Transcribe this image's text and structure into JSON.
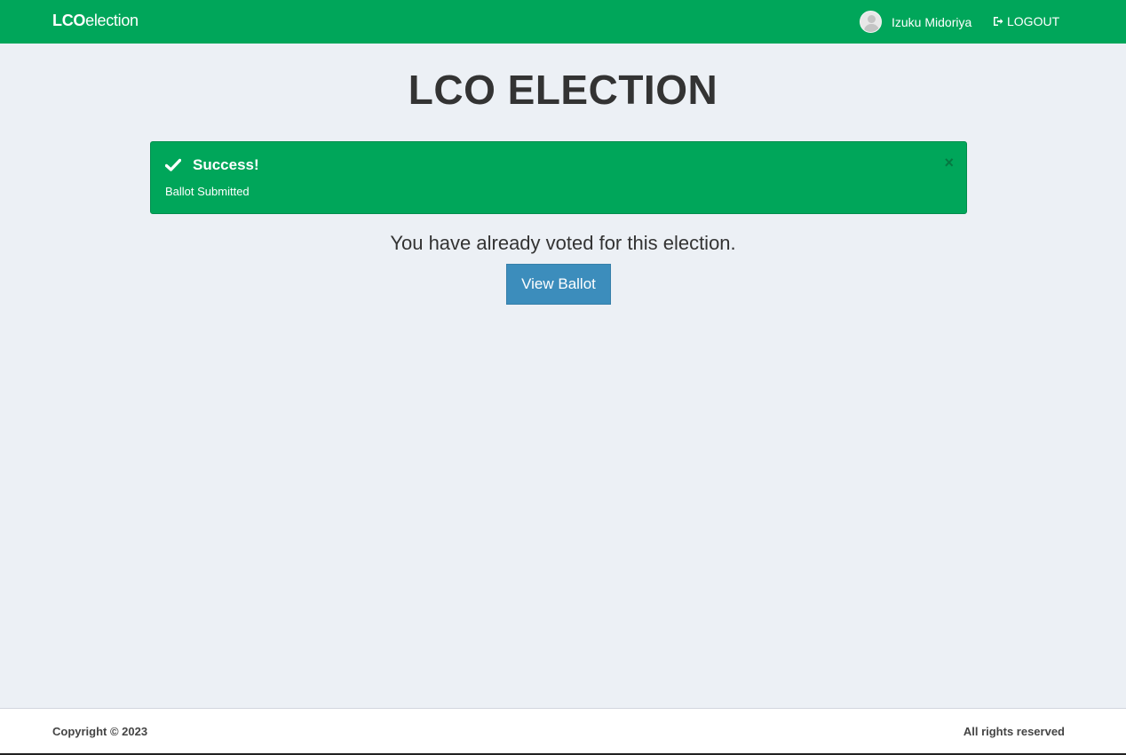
{
  "navbar": {
    "brand_bold": "LCO",
    "brand_rest": "election",
    "user_name": "Izuku Midoriya",
    "logout_label": "LOGOUT",
    "color": "#00a65a"
  },
  "main": {
    "title": "LCO ELECTION",
    "alert": {
      "heading": "Success!",
      "message": "Ballot Submitted",
      "close_label": "×",
      "icon": "check-icon"
    },
    "voted_message": "You have already voted for this election.",
    "view_ballot_label": "View Ballot"
  },
  "footer": {
    "copyright": "Copyright © 2023",
    "rights": "All rights reserved"
  },
  "colors": {
    "background": "#ecf0f5",
    "success": "#00a65a",
    "primary_button": "#3c8dbc"
  }
}
